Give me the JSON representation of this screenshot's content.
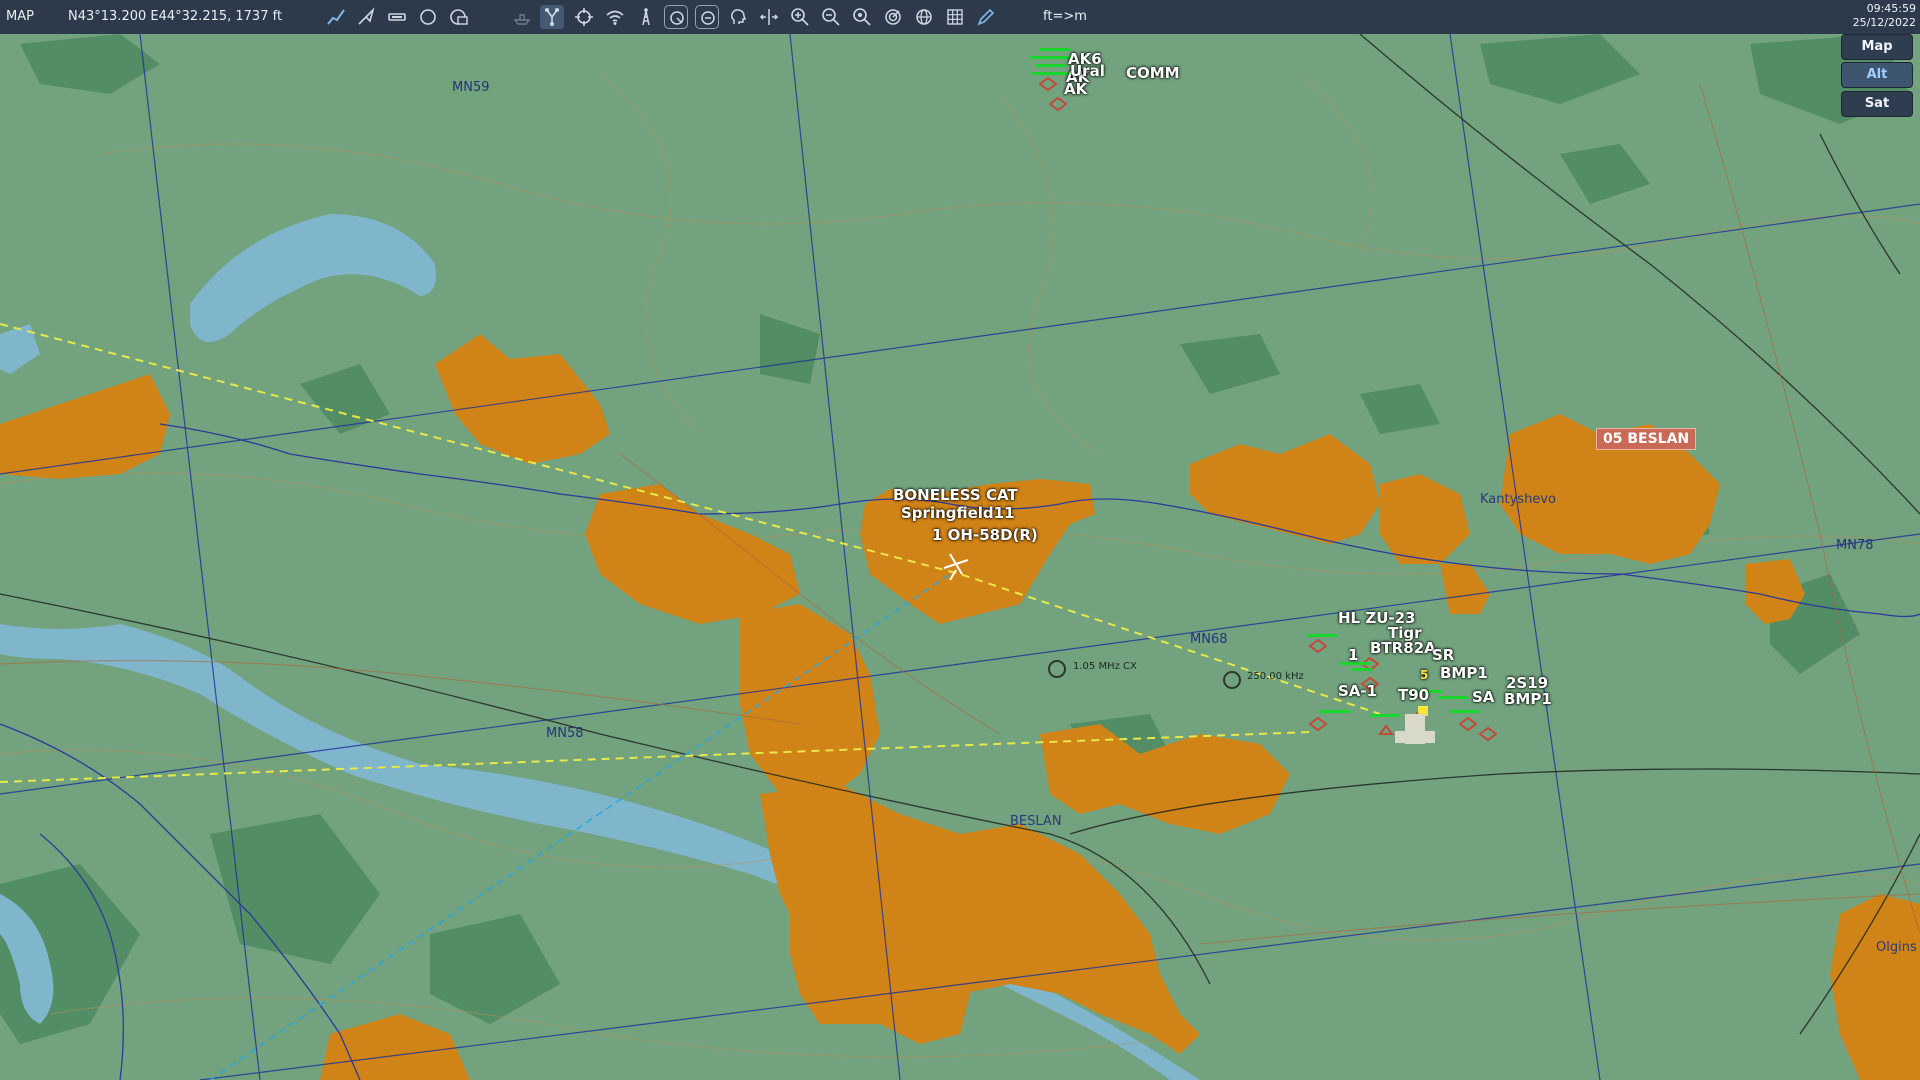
{
  "toolbar": {
    "mode_label": "MAP",
    "coordinates": "N43°13.200 E44°32.215, 1737 ft",
    "units_label": "ft=>m",
    "time": "09:45:59",
    "date": "25/12/2022",
    "icons": [
      "route-icon",
      "waypoint-arrow-icon",
      "ruler-icon",
      "circle-tool-icon",
      "message-layers-icon",
      "ship-icon",
      "branch-icon",
      "crosshair-icon",
      "wifi-icon",
      "tower-icon",
      "target-ring-icon",
      "target-ring-2-icon",
      "head-icon",
      "split-arrows-icon",
      "zoom-in-icon",
      "zoom-out-icon",
      "zoom-fit-icon",
      "radar-icon",
      "globe-icon",
      "grid-icon",
      "pencil-icon"
    ]
  },
  "layers": {
    "map": "Map",
    "alt": "Alt",
    "sat": "Sat",
    "selected": "Alt"
  },
  "map_labels": {
    "grid": [
      "MN59",
      "MN68",
      "MN58",
      "MN78"
    ],
    "towns": [
      "Kantyshevo",
      "BESLAN",
      "Olgins"
    ],
    "airfield_badge": "05 BESLAN",
    "frequencies": [
      "1.05 MHz CX",
      "250.00 kHz"
    ]
  },
  "units": {
    "player_group": "BONELESS CAT",
    "player_callsign": "Springfield11",
    "player_aircraft": "1 OH-58D(R)",
    "north_cluster": [
      "AK6",
      "AK",
      "Ural",
      "COMM",
      "AK"
    ],
    "east_cluster": [
      "HL ZU-23",
      "Tigr",
      "BTR82A",
      "1",
      "SR",
      "BMP1",
      "2S19",
      "T90",
      "SA-1",
      "SA",
      "BMP1",
      "5"
    ]
  },
  "colors": {
    "terrain": "#72a27e",
    "urban": "#d08316",
    "forest": "#4e8a60",
    "river": "#7fb6cc",
    "route": "#e8e84a",
    "enemy_marker": "#d94a3a",
    "friendly_marker": "#2f4fd8",
    "health_bar": "#19d62a"
  }
}
